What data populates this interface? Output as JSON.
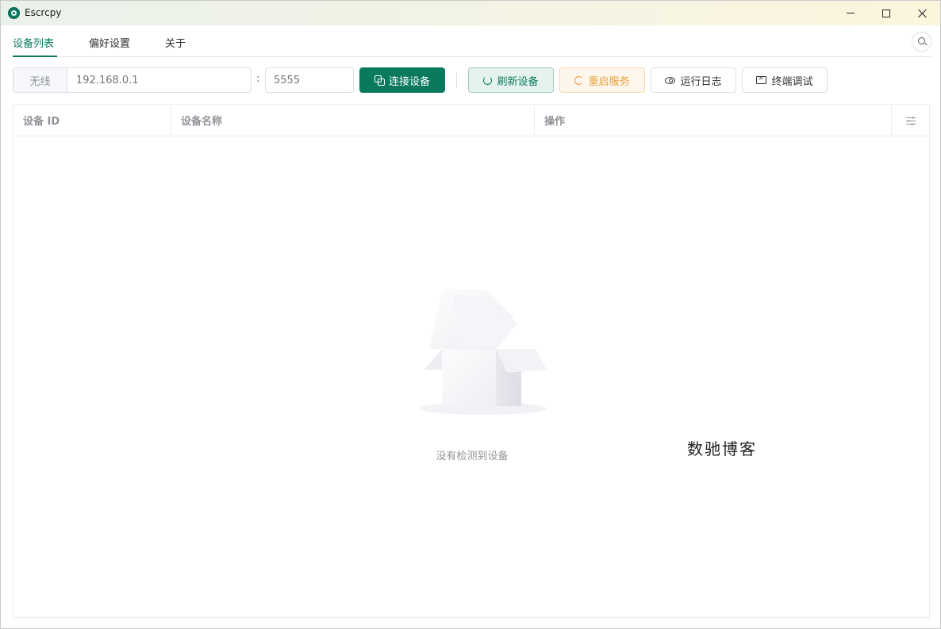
{
  "window": {
    "title": "Escrcpy"
  },
  "tabs": [
    {
      "label": "设备列表",
      "active": true
    },
    {
      "label": "偏好设置",
      "active": false
    },
    {
      "label": "关于",
      "active": false
    }
  ],
  "toolbar": {
    "wireless_label": "无线",
    "ip_placeholder": "192.168.0.1",
    "colon": ":",
    "port_placeholder": "5555",
    "connect_label": "连接设备",
    "refresh_label": "刷新设备",
    "restart_label": "重启服务",
    "log_label": "运行日志",
    "terminal_label": "终端调试"
  },
  "table": {
    "columns": [
      "设备 ID",
      "设备名称",
      "操作"
    ],
    "empty_text": "没有检测到设备"
  },
  "watermark": "数驰博客",
  "colors": {
    "primary": "#0a7a5e",
    "warning": "#e6a23c",
    "muted": "#909399"
  }
}
